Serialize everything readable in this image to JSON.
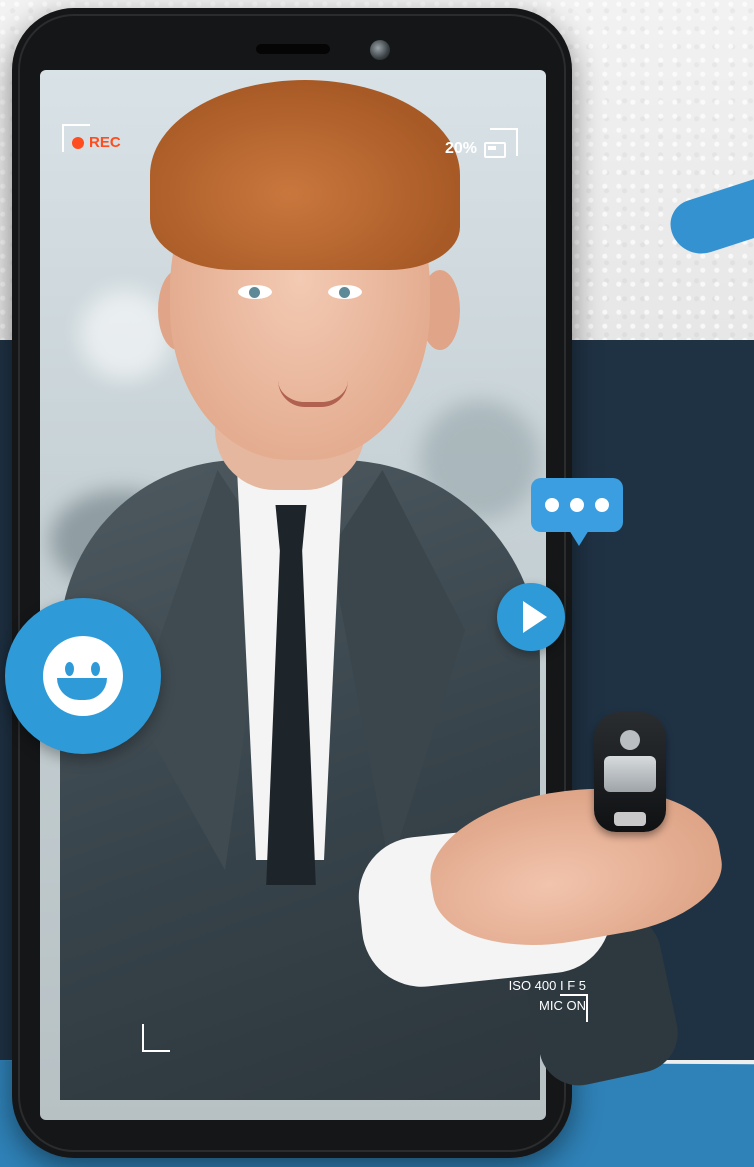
{
  "hud": {
    "rec_label": "REC",
    "battery": "20%",
    "iso_line": "ISO 400 I F 5",
    "mic_line": "MIC ON"
  },
  "icons": {
    "smiley": "smiley-face-icon",
    "chat": "chat-bubble-icon",
    "play": "play-icon",
    "rec": "record-dot-icon",
    "battery": "battery-icon"
  },
  "colors": {
    "navy_background": "#1f3244",
    "accent_blue": "#2f9ad8",
    "rec_orange": "#ff4d1f"
  }
}
